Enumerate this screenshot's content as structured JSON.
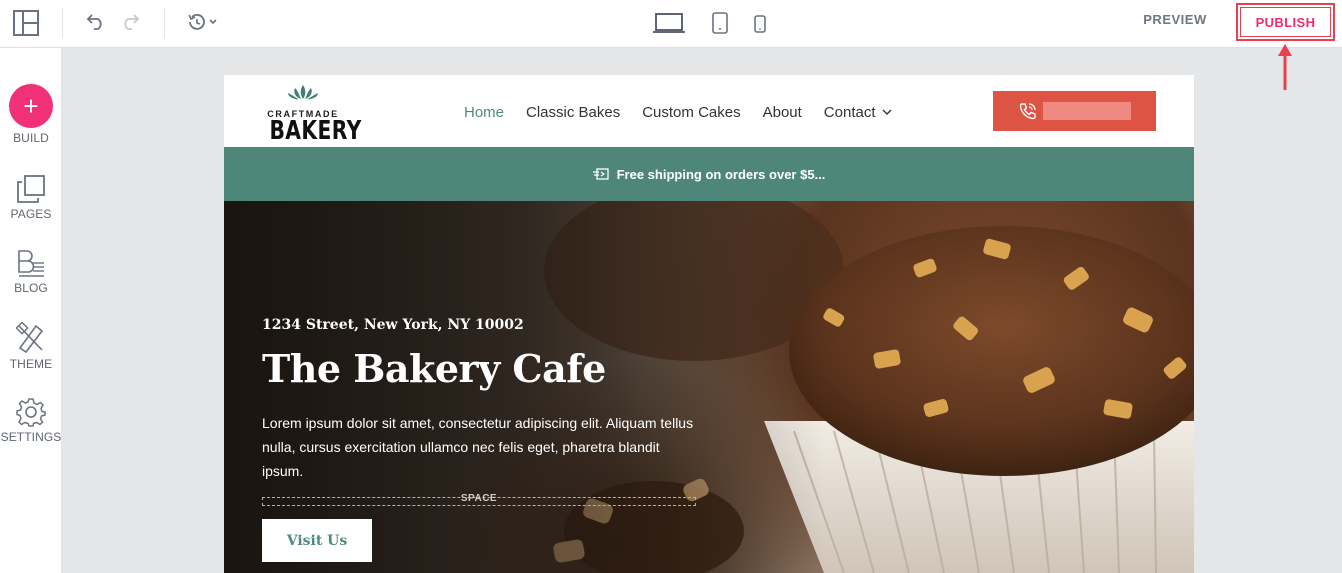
{
  "toolbar": {
    "preview_label": "PREVIEW",
    "publish_label": "PUBLISH",
    "icons": [
      "layout-icon",
      "undo-icon",
      "redo-icon",
      "history-icon",
      "desktop-icon",
      "tablet-icon",
      "mobile-icon"
    ]
  },
  "sidebar": {
    "items": [
      {
        "label": "BUILD",
        "icon": "plus-icon"
      },
      {
        "label": "PAGES",
        "icon": "pages-icon"
      },
      {
        "label": "BLOG",
        "icon": "blog-icon"
      },
      {
        "label": "THEME",
        "icon": "theme-icon"
      },
      {
        "label": "SETTINGS",
        "icon": "gear-icon"
      }
    ]
  },
  "site": {
    "logo_small": "CRAFTMADE",
    "logo_big": "BAKERY",
    "nav": [
      {
        "label": "Home"
      },
      {
        "label": "Classic Bakes"
      },
      {
        "label": "Custom Cakes"
      },
      {
        "label": "About"
      },
      {
        "label": "Contact"
      }
    ],
    "banner_text": "Free shipping on orders over $5...",
    "hero": {
      "address": "1234 Street, New York, NY 10002",
      "title": "The Bakery Cafe",
      "text": "Lorem ipsum dolor sit amet, consectetur adipiscing elit. Aliquam tellus nulla, cursus exercitation ullamco nec felis eget, pharetra blandit ipsum.",
      "space_label": "SPACE",
      "button_label": "Visit Us"
    }
  },
  "colors": {
    "publish": "#ec2d6f",
    "build": "#f0317a",
    "accent_green": "#4e877a",
    "cta_red": "#dd5444"
  }
}
